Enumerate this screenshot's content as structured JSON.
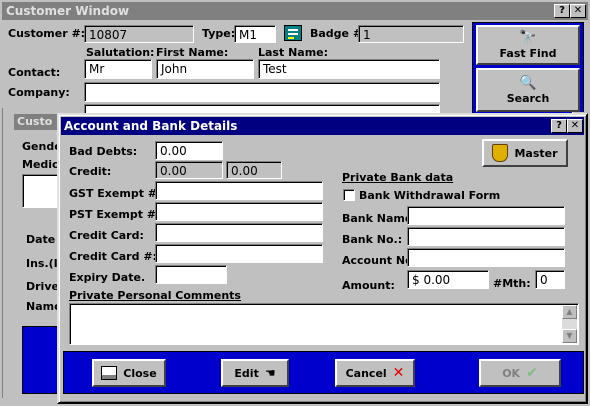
{
  "customer_window": {
    "title": "Customer Window",
    "help_btn": "?",
    "close_btn": "✕",
    "customer_label": "Customer #:",
    "customer_value": "10807",
    "type_label": "Type:",
    "type_value": "M1",
    "badge_label": "Badge #:",
    "badge_value": "1",
    "salutation_header": "Salutation:",
    "firstname_header": "First Name:",
    "lastname_header": "Last Name:",
    "contact_label": "Contact:",
    "salutation_value": "Mr",
    "firstname_value": "John",
    "lastname_value": "Test",
    "company_label": "Company:",
    "company_value": "",
    "fast_find_label": "Fast Find",
    "search_label": "Search",
    "sub_title": "Custo",
    "partial_labels": [
      "Gender",
      "Medica",
      "Date o",
      "Ins.(I",
      "Drive",
      "Name"
    ]
  },
  "account_dialog": {
    "title": "Account and Bank Details",
    "help_btn": "?",
    "close_btn": "✕",
    "master_label": "Master",
    "bad_debts_label": "Bad Debts:",
    "bad_debts_value": "0.00",
    "credit_label": "Credit:",
    "credit_value1": "0.00",
    "credit_value2": "0.00",
    "gst_label": "GST Exempt #:",
    "gst_value": "",
    "pst_label": "PST Exempt #:",
    "pst_value": "",
    "credit_card_label": "Credit Card:",
    "credit_card_value": "",
    "credit_card_no_label": "Credit Card #:",
    "credit_card_no_value": "",
    "expiry_label": "Expiry Date.",
    "expiry_value": "",
    "private_bank_header": "Private Bank data",
    "bank_withdrawal_label": "Bank Withdrawal Form",
    "bank_withdrawal_checked": false,
    "bank_name_label": "Bank Name:",
    "bank_name_value": "",
    "bank_no_label": "Bank No.:",
    "bank_no_value": "",
    "account_no_label": "Account No.:",
    "account_no_value": "",
    "amount_label": "Amount:",
    "amount_value": "$ 0.00",
    "mth_label": "#Mth:",
    "mth_value": "0",
    "comments_header": "Private Personal Comments",
    "comments_value": "",
    "close_button": "Close",
    "edit_button": "Edit",
    "cancel_button": "Cancel",
    "ok_button": "OK"
  }
}
